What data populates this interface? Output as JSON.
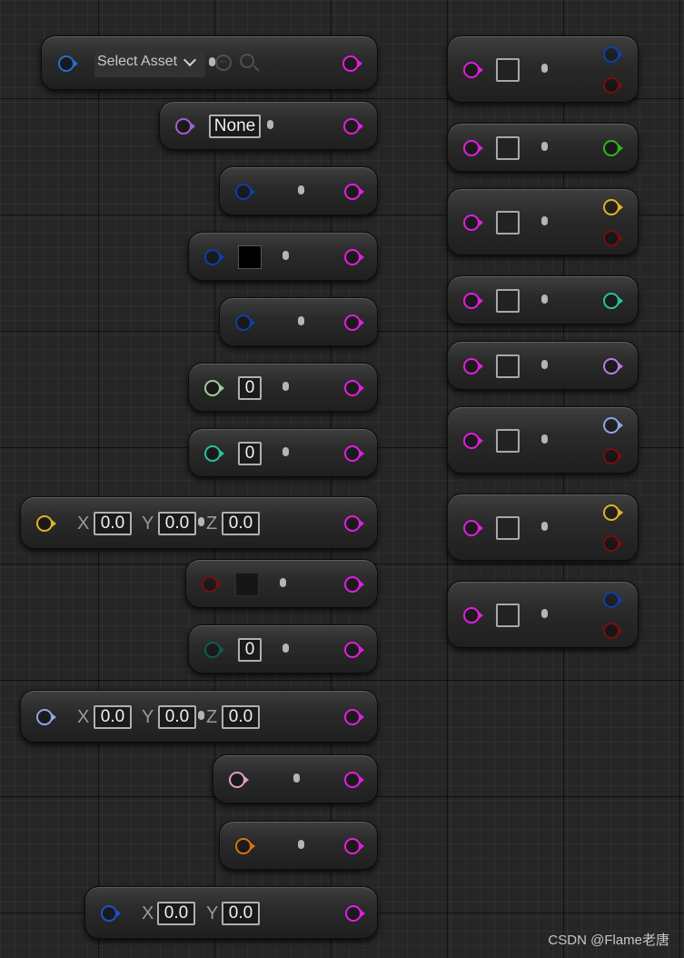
{
  "colors": {
    "magenta": "#e21ee0",
    "object_blue": "#1e6fd6",
    "struct_blue": "#0d3fa8",
    "class_purple": "#a35fd3",
    "int_green_pale": "#9fcc9c",
    "int64_teal": "#23c4a0",
    "vector_gold": "#e3b125",
    "linear_color_red": "#7a0d0d",
    "byte_teal_dark": "#0b5c52",
    "vector3_lavender": "#8ea6e8",
    "rotator_pink": "#e79cc6",
    "orange": "#d9720f",
    "bool_green": "#32b41b",
    "name_lilac": "#b57de3"
  },
  "icons": {
    "back": "arrow-left-circle-icon",
    "search": "magnifier-icon",
    "chevron": "chevron-down-icon"
  },
  "nodes": {
    "asset_select": {
      "label": "Select Asset"
    },
    "class_select": {
      "value": "None"
    },
    "int_node": {
      "value": "0"
    },
    "int64_node": {
      "value": "0"
    },
    "vector_node": {
      "x_label": "X",
      "x": "0.0",
      "y_label": "Y",
      "y": "0.0",
      "z_label": "Z",
      "z": "0.0"
    },
    "byte_node": {
      "value": "0"
    },
    "vector3_node": {
      "x_label": "X",
      "x": "0.0",
      "y_label": "Y",
      "y": "0.0",
      "z_label": "Z",
      "z": "0.0"
    },
    "vector2d_node": {
      "x_label": "X",
      "x": "0.0",
      "y_label": "Y",
      "y": "0.0"
    }
  },
  "watermark": "CSDN @Flame老唐"
}
